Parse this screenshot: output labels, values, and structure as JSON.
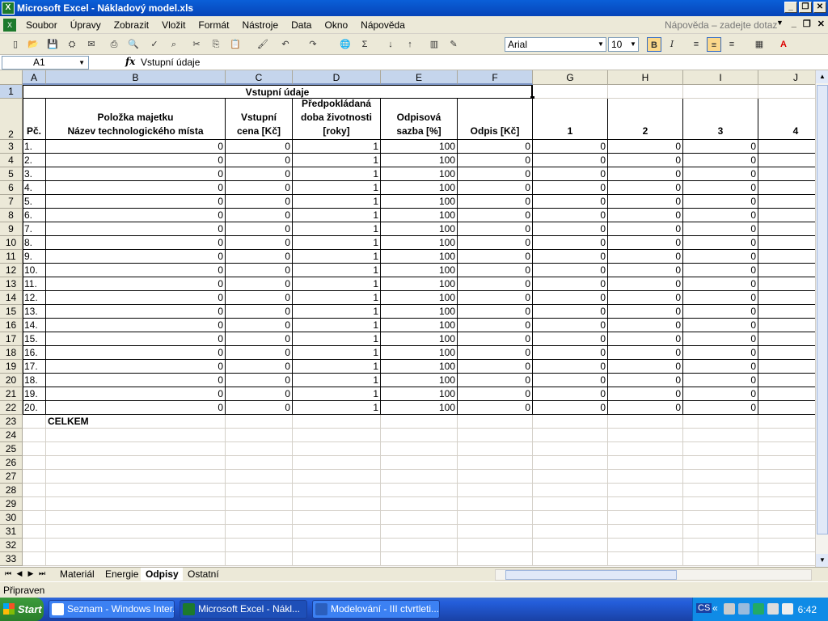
{
  "window": {
    "title": "Microsoft Excel - Nákladový model.xls"
  },
  "menu": {
    "items": [
      "Soubor",
      "Úpravy",
      "Zobrazit",
      "Vložit",
      "Formát",
      "Nástroje",
      "Data",
      "Okno",
      "Nápověda"
    ],
    "help_placeholder": "Nápověda – zadejte dotaz"
  },
  "toolbar": {
    "font": "Arial",
    "font_size": "10",
    "bold": "B",
    "italic": "I"
  },
  "formula": {
    "cell_ref": "A1",
    "fx": "fx",
    "content": "Vstupní údaje"
  },
  "sheet": {
    "columns": [
      "A",
      "B",
      "C",
      "D",
      "E",
      "F",
      "G",
      "H",
      "I",
      "J"
    ],
    "row1_title": "Vstupní údaje",
    "headers": {
      "pc": "Pč.",
      "b_line1": "Položka majetku",
      "b_line2": "Název technologického místa",
      "c_line1": "Vstupní",
      "c_line2": "cena [Kč]",
      "d_line1": "Předpokládaná",
      "d_line2": "doba životnosti",
      "d_line3": "[roky]",
      "e_line1": "Odpisová",
      "e_line2": "sazba [%]",
      "f": "Odpis [Kč]",
      "g": "1",
      "h": "2",
      "i": "3",
      "j": "4"
    },
    "data_rows": [
      {
        "pc": "1.",
        "b": "0",
        "c": "0",
        "d": "1",
        "e": "100",
        "f": "0",
        "g": "0",
        "h": "0",
        "i": "0"
      },
      {
        "pc": "2.",
        "b": "0",
        "c": "0",
        "d": "1",
        "e": "100",
        "f": "0",
        "g": "0",
        "h": "0",
        "i": "0"
      },
      {
        "pc": "3.",
        "b": "0",
        "c": "0",
        "d": "1",
        "e": "100",
        "f": "0",
        "g": "0",
        "h": "0",
        "i": "0"
      },
      {
        "pc": "4.",
        "b": "0",
        "c": "0",
        "d": "1",
        "e": "100",
        "f": "0",
        "g": "0",
        "h": "0",
        "i": "0"
      },
      {
        "pc": "5.",
        "b": "0",
        "c": "0",
        "d": "1",
        "e": "100",
        "f": "0",
        "g": "0",
        "h": "0",
        "i": "0"
      },
      {
        "pc": "6.",
        "b": "0",
        "c": "0",
        "d": "1",
        "e": "100",
        "f": "0",
        "g": "0",
        "h": "0",
        "i": "0"
      },
      {
        "pc": "7.",
        "b": "0",
        "c": "0",
        "d": "1",
        "e": "100",
        "f": "0",
        "g": "0",
        "h": "0",
        "i": "0"
      },
      {
        "pc": "8.",
        "b": "0",
        "c": "0",
        "d": "1",
        "e": "100",
        "f": "0",
        "g": "0",
        "h": "0",
        "i": "0"
      },
      {
        "pc": "9.",
        "b": "0",
        "c": "0",
        "d": "1",
        "e": "100",
        "f": "0",
        "g": "0",
        "h": "0",
        "i": "0"
      },
      {
        "pc": "10.",
        "b": "0",
        "c": "0",
        "d": "1",
        "e": "100",
        "f": "0",
        "g": "0",
        "h": "0",
        "i": "0"
      },
      {
        "pc": "11.",
        "b": "0",
        "c": "0",
        "d": "1",
        "e": "100",
        "f": "0",
        "g": "0",
        "h": "0",
        "i": "0"
      },
      {
        "pc": "12.",
        "b": "0",
        "c": "0",
        "d": "1",
        "e": "100",
        "f": "0",
        "g": "0",
        "h": "0",
        "i": "0"
      },
      {
        "pc": "13.",
        "b": "0",
        "c": "0",
        "d": "1",
        "e": "100",
        "f": "0",
        "g": "0",
        "h": "0",
        "i": "0"
      },
      {
        "pc": "14.",
        "b": "0",
        "c": "0",
        "d": "1",
        "e": "100",
        "f": "0",
        "g": "0",
        "h": "0",
        "i": "0"
      },
      {
        "pc": "15.",
        "b": "0",
        "c": "0",
        "d": "1",
        "e": "100",
        "f": "0",
        "g": "0",
        "h": "0",
        "i": "0"
      },
      {
        "pc": "16.",
        "b": "0",
        "c": "0",
        "d": "1",
        "e": "100",
        "f": "0",
        "g": "0",
        "h": "0",
        "i": "0"
      },
      {
        "pc": "17.",
        "b": "0",
        "c": "0",
        "d": "1",
        "e": "100",
        "f": "0",
        "g": "0",
        "h": "0",
        "i": "0"
      },
      {
        "pc": "18.",
        "b": "0",
        "c": "0",
        "d": "1",
        "e": "100",
        "f": "0",
        "g": "0",
        "h": "0",
        "i": "0"
      },
      {
        "pc": "19.",
        "b": "0",
        "c": "0",
        "d": "1",
        "e": "100",
        "f": "0",
        "g": "0",
        "h": "0",
        "i": "0"
      },
      {
        "pc": "20.",
        "b": "0",
        "c": "0",
        "d": "1",
        "e": "100",
        "f": "0",
        "g": "0",
        "h": "0",
        "i": "0"
      }
    ],
    "total_label": "CELKEM",
    "row_numbers": [
      "1",
      "2",
      "3",
      "4",
      "5",
      "6",
      "7",
      "8",
      "9",
      "10",
      "11",
      "12",
      "13",
      "14",
      "15",
      "16",
      "17",
      "18",
      "19",
      "20",
      "21",
      "22",
      "23",
      "24",
      "25",
      "26",
      "27",
      "28",
      "29",
      "30",
      "31",
      "32",
      "33"
    ]
  },
  "tabs": [
    "Materiál",
    "Energie",
    "Odpisy",
    "Ostatní"
  ],
  "active_tab": "Odpisy",
  "status": "Připraven",
  "taskbar": {
    "start": "Start",
    "tasks": [
      "Seznam - Windows Inter...",
      "Microsoft Excel - Nákl...",
      "Modelování - III ctvrtleti...."
    ],
    "clock": "6:42",
    "lang": "CS"
  },
  "colors": {
    "title_blue": "#0a5fd8",
    "chrome": "#ece9d8",
    "selected_header": "#c5d5ec"
  }
}
